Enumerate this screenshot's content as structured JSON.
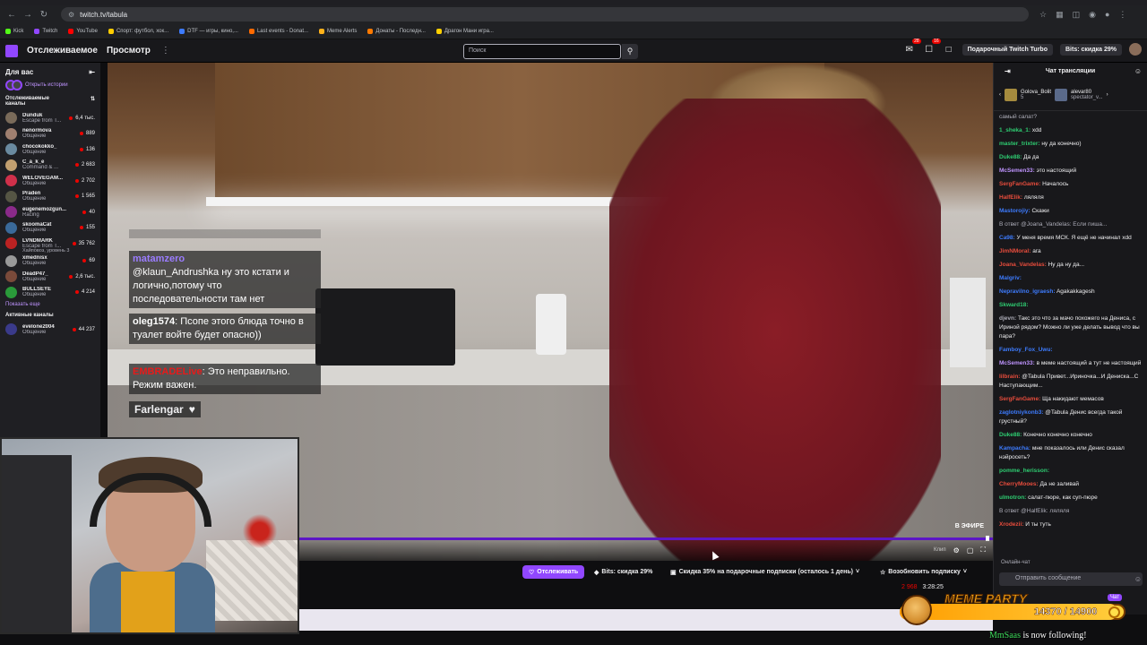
{
  "browser": {
    "url": "twitch.tv/tabula",
    "bookmarks": [
      {
        "label": "Kick",
        "color": "#53fc18"
      },
      {
        "label": "Twitch",
        "color": "#9147ff"
      },
      {
        "label": "YouTube",
        "color": "#ff0000"
      },
      {
        "label": "Спорт: футбол, хок...",
        "color": "#ffcc00"
      },
      {
        "label": "DTF — игры, кино,...",
        "color": "#3d7bfd"
      },
      {
        "label": "Last events - Donat...",
        "color": "#ff6a00"
      },
      {
        "label": "Meme Alerts",
        "color": "#ffb21a"
      },
      {
        "label": "Донаты - Последн...",
        "color": "#ff7a00"
      },
      {
        "label": "Драгон Мани игра...",
        "color": "#ffd000"
      }
    ]
  },
  "topnav": {
    "following": "Отслеживаемое",
    "browse": "Просмотр",
    "search_placeholder": "Поиск",
    "badge_1": "28",
    "badge_2": "16",
    "turbo": "Подарочный Twitch Turbo",
    "bits": "Bits: скидка 29%"
  },
  "sidebar": {
    "header": "Для вас",
    "stories": "Открыть истории",
    "section_following": "Отслеживаемые каналы",
    "channels": [
      {
        "name": "Dunduk",
        "game": "Escape from T...",
        "viewers": "6,4 тыс.",
        "color": "#7a6b5a"
      },
      {
        "name": "nenormova",
        "game": "Общение",
        "viewers": "889",
        "color": "#a08070"
      },
      {
        "name": "chocokokko_",
        "game": "Общение",
        "viewers": "136",
        "color": "#6a8aa0"
      },
      {
        "name": "C_a_k_e",
        "game": "Command & ...",
        "viewers": "2 683",
        "color": "#c2a070"
      },
      {
        "name": "WELOVEGAM...",
        "game": "Общение",
        "viewers": "2 702",
        "color": "#d0304a"
      },
      {
        "name": "Praden",
        "game": "Общение",
        "viewers": "1 565",
        "color": "#554"
      },
      {
        "name": "eugenemozgun...",
        "game": "Racing",
        "viewers": "40",
        "color": "#8a2a8a"
      },
      {
        "name": "skoomaCat",
        "game": "Общение",
        "viewers": "155",
        "color": "#3a6a9a"
      },
      {
        "name": "LVNDMARK",
        "game": "Escape from T...",
        "viewers": "35 762",
        "color": "#b22"
      },
      {
        "name": "xmednisx",
        "game": "Общение",
        "viewers": "69",
        "color": "#999"
      },
      {
        "name": "DeadP47_",
        "game": "Общение",
        "viewers": "2,6 тыс.",
        "color": "#7a4a3a"
      },
      {
        "name": "BULLSEYE",
        "game": "Общение",
        "viewers": "4 214",
        "color": "#2a9a3a"
      }
    ],
    "level_text": "Хайповоз, уровень 3",
    "show_more": "Показать еще",
    "section_active": "Активные каналы",
    "active": [
      {
        "name": "evelone2004",
        "game": "Общение",
        "viewers": "44 237",
        "color": "#3a3a8a"
      }
    ]
  },
  "overlay_chat": [
    {
      "name": "matamzero",
      "text": "@klaun_Andrushka ну это кстати и логично,потому что последовательности там нет",
      "name_class": "purple"
    },
    {
      "name": "oleg1574",
      "text": "Псопе этого блюда точно в туалет войте будет опасно))",
      "name_class": ""
    },
    {
      "name": "EMBRADELive",
      "text": "Это неправильно. Режим важен.",
      "name_class": "red"
    }
  ],
  "overlay_last": "Farlengar",
  "player": {
    "live": "В ЭФИРЕ",
    "clip": "Клип"
  },
  "below": {
    "follow": "Отслеживать",
    "bits": "Bits: скидка 29%",
    "gift": "Скидка 35% на подарочные подписки (осталось 1 день)",
    "resub": "Возобновить подписку",
    "viewers": "2 968",
    "uptime": "3:28:25"
  },
  "chat": {
    "title": "Чат трансляции",
    "pinned": [
      {
        "name": "Golova_Bolit",
        "sub": "5"
      },
      {
        "name": "alevar80",
        "sub": "spectator_v..."
      }
    ],
    "messages": [
      {
        "user": "",
        "text": "самый салат?",
        "color": "#efeff1"
      },
      {
        "user": "1_sheka_1:",
        "text": "xdd",
        "color": "#2ecc71"
      },
      {
        "user": "master_trixter:",
        "text": "ну да конечно)",
        "color": "#2ecc71"
      },
      {
        "user": "Duke88:",
        "text": "Да да",
        "color": "#2ecc71"
      },
      {
        "user": "McSemen33:",
        "text": "это настоящий",
        "color": "#bf94ff"
      },
      {
        "user": "SergFanGame:",
        "text": "Началось",
        "color": "#e74c3c"
      },
      {
        "user": "HalfElik:",
        "text": "ляляля",
        "color": "#e74c3c"
      },
      {
        "user": "Mastorojiy:",
        "text": "Скажи",
        "color": "#3d7bfd"
      },
      {
        "user": "",
        "text": "В ответ @Joana_Vandelas: Если пиша...",
        "color": "#adadb8"
      },
      {
        "user": "Ca98:",
        "text": "У меня время МСК. Я ещё не начинал xdd",
        "color": "#3d7bfd"
      },
      {
        "user": "JimNMoral:",
        "text": "ага",
        "color": "#e74c3c"
      },
      {
        "user": "Joana_Vandelas:",
        "text": "Ну да ну да...",
        "color": "#e74c3c"
      },
      {
        "user": "Malgriv:",
        "text": "",
        "color": "#3d7bfd"
      },
      {
        "user": "Nepravilno_igraesh:",
        "text": "Agakakkagesh",
        "color": "#3d7bfd"
      },
      {
        "user": "Skward18:",
        "text": "",
        "color": "#2ecc71"
      },
      {
        "user": "djevn:",
        "text": "Такс это что за мачо похожего на Дениса, с Ириной рядом? Можно ли уже делать вывод что вы пара?",
        "color": "#adadb8"
      },
      {
        "user": "Famboy_Fox_Uwu:",
        "text": "",
        "color": "#3d7bfd"
      },
      {
        "user": "McSemen33:",
        "text": "в меме настоящий а тут не настоящий",
        "color": "#bf94ff"
      },
      {
        "user": "lilbrain:",
        "text": "@Tabula Привет...Ириночка...И Дениска...С Наступающим...",
        "color": "#e74c3c"
      },
      {
        "user": "SergFanGame:",
        "text": "Ща накидают мемасов",
        "color": "#e74c3c"
      },
      {
        "user": "zaglotniykonb3:",
        "text": "@Tabula Денис всегда такой грустный?",
        "color": "#3d7bfd"
      },
      {
        "user": "Duke88:",
        "text": "Конечно конечно конечно",
        "color": "#2ecc71"
      },
      {
        "user": "Kampacha:",
        "text": "мне показалось или Денис сказал нэйросеть?",
        "color": "#3d7bfd"
      },
      {
        "user": "pomme_herisson:",
        "text": "",
        "color": "#2ecc71"
      },
      {
        "user": "CherryMooes:",
        "text": "Да не заливай",
        "color": "#e74c3c"
      },
      {
        "user": "ulmotron:",
        "text": "салат-пюре, как суп-пюре",
        "color": "#2ecc71"
      },
      {
        "user": "",
        "text": "В ответ @HalfElik: ляляля",
        "color": "#adadb8"
      },
      {
        "user": "Xrodezii:",
        "text": "И ты туть",
        "color": "#e74c3c"
      }
    ],
    "online": "Онлайн-чат",
    "input_placeholder": "Отправить сообщение"
  },
  "meme_party": {
    "title": "MEME PARTY",
    "count": "14370 / 14900",
    "progress": 0.9644,
    "chat_tag": "Чат"
  },
  "alert": {
    "name": "MmSaas",
    "text": " is now following!"
  }
}
